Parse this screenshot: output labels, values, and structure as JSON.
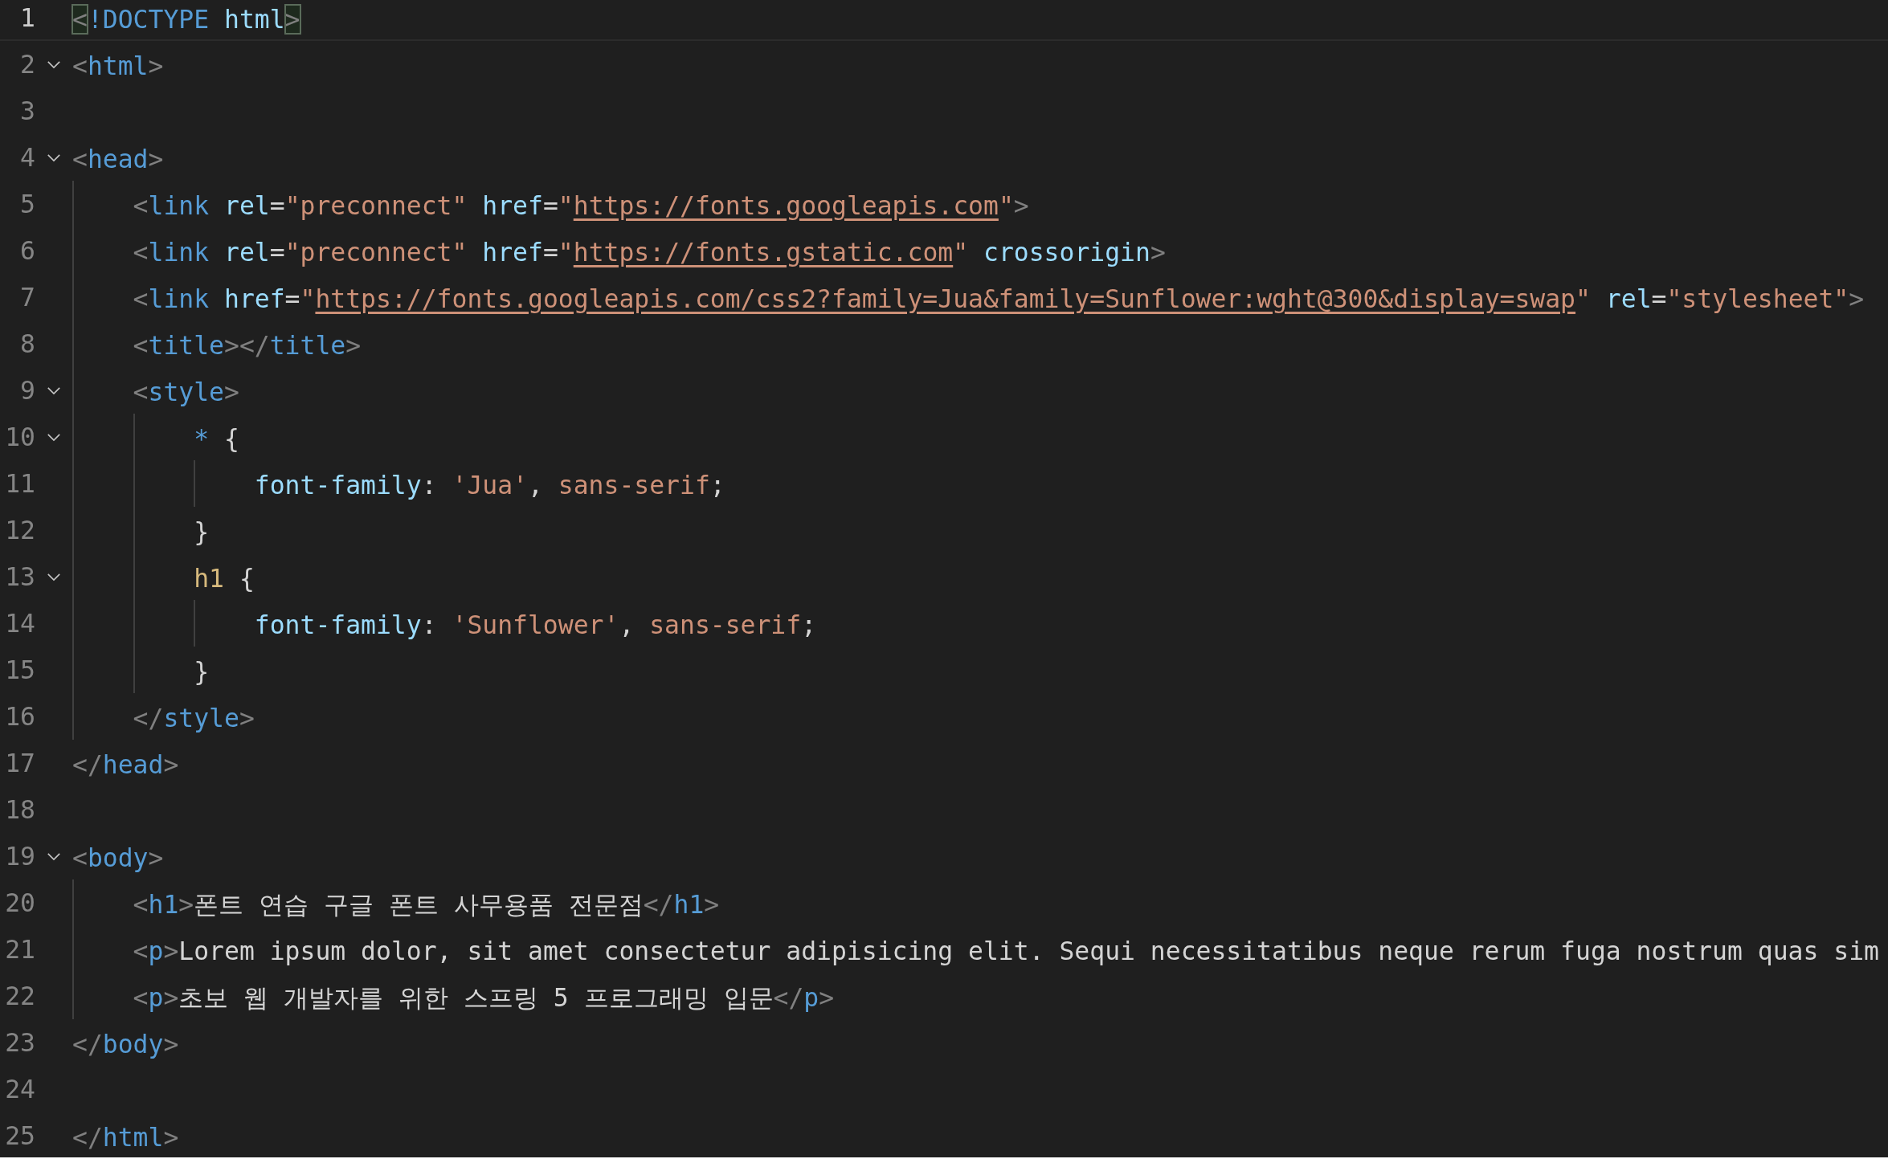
{
  "editor": {
    "lines": [
      {
        "number": "1",
        "fold": false,
        "current": true,
        "tokens": [
          {
            "kind": "bracket-match",
            "text": "<"
          },
          {
            "kind": "tag",
            "text": "!DOCTYPE"
          },
          {
            "kind": "attr",
            "text": " html"
          },
          {
            "kind": "bracket-match",
            "text": ">"
          }
        ]
      },
      {
        "number": "2",
        "fold": true,
        "current": false,
        "tokens": [
          {
            "kind": "punct",
            "text": "<"
          },
          {
            "kind": "tag",
            "text": "html"
          },
          {
            "kind": "punct",
            "text": ">"
          }
        ]
      },
      {
        "number": "3",
        "fold": false,
        "current": false
      },
      {
        "number": "4",
        "fold": true,
        "current": false,
        "tokens": [
          {
            "kind": "punct",
            "text": "<"
          },
          {
            "kind": "tag",
            "text": "head"
          },
          {
            "kind": "punct",
            "text": ">"
          }
        ]
      },
      {
        "number": "5",
        "fold": false,
        "current": false,
        "tokens": [
          {
            "kind": "punct",
            "text": "    <"
          },
          {
            "kind": "tag",
            "text": "link"
          },
          {
            "kind": "attr",
            "text": " rel"
          },
          {
            "kind": "text",
            "text": "="
          },
          {
            "kind": "string",
            "text": "\"preconnect\""
          },
          {
            "kind": "attr",
            "text": " href"
          },
          {
            "kind": "text",
            "text": "="
          },
          {
            "kind": "string",
            "text": "\""
          },
          {
            "kind": "link",
            "text": "https://fonts.googleapis.com"
          },
          {
            "kind": "string",
            "text": "\""
          },
          {
            "kind": "punct",
            "text": ">"
          }
        ]
      },
      {
        "number": "6",
        "fold": false,
        "current": false,
        "tokens": [
          {
            "kind": "punct",
            "text": "    <"
          },
          {
            "kind": "tag",
            "text": "link"
          },
          {
            "kind": "attr",
            "text": " rel"
          },
          {
            "kind": "text",
            "text": "="
          },
          {
            "kind": "string",
            "text": "\"preconnect\""
          },
          {
            "kind": "attr",
            "text": " href"
          },
          {
            "kind": "text",
            "text": "="
          },
          {
            "kind": "string",
            "text": "\""
          },
          {
            "kind": "link",
            "text": "https://fonts.gstatic.com"
          },
          {
            "kind": "string",
            "text": "\""
          },
          {
            "kind": "attr",
            "text": " crossorigin"
          },
          {
            "kind": "punct",
            "text": ">"
          }
        ]
      },
      {
        "number": "7",
        "fold": false,
        "current": false,
        "tokens": [
          {
            "kind": "punct",
            "text": "    <"
          },
          {
            "kind": "tag",
            "text": "link"
          },
          {
            "kind": "attr",
            "text": " href"
          },
          {
            "kind": "text",
            "text": "="
          },
          {
            "kind": "string",
            "text": "\""
          },
          {
            "kind": "link",
            "text": "https://fonts.googleapis.com/css2?family=Jua&family=Sunflower:wght@300&display=swap"
          },
          {
            "kind": "string",
            "text": "\""
          },
          {
            "kind": "attr",
            "text": " rel"
          },
          {
            "kind": "text",
            "text": "="
          },
          {
            "kind": "string",
            "text": "\"stylesheet\""
          },
          {
            "kind": "punct",
            "text": ">"
          }
        ]
      },
      {
        "number": "8",
        "fold": false,
        "current": false,
        "tokens": [
          {
            "kind": "punct",
            "text": "    <"
          },
          {
            "kind": "tag",
            "text": "title"
          },
          {
            "kind": "punct",
            "text": "></"
          },
          {
            "kind": "tag",
            "text": "title"
          },
          {
            "kind": "punct",
            "text": ">"
          }
        ]
      },
      {
        "number": "9",
        "fold": true,
        "current": false,
        "tokens": [
          {
            "kind": "punct",
            "text": "    <"
          },
          {
            "kind": "tag",
            "text": "style"
          },
          {
            "kind": "punct",
            "text": ">"
          }
        ]
      },
      {
        "number": "10",
        "fold": true,
        "current": false,
        "tokens": [
          {
            "kind": "tag",
            "text": "        *"
          },
          {
            "kind": "text",
            "text": " {"
          }
        ]
      },
      {
        "number": "11",
        "fold": false,
        "current": false,
        "tokens": [
          {
            "kind": "attr",
            "text": "            font-family"
          },
          {
            "kind": "text",
            "text": ":"
          },
          {
            "kind": "string",
            "text": " 'Jua'"
          },
          {
            "kind": "text",
            "text": ","
          },
          {
            "kind": "string",
            "text": " sans-serif"
          },
          {
            "kind": "text",
            "text": ";"
          }
        ]
      },
      {
        "number": "12",
        "fold": false,
        "current": false,
        "tokens": [
          {
            "kind": "text",
            "text": "        }"
          }
        ]
      },
      {
        "number": "13",
        "fold": true,
        "current": false,
        "tokens": [
          {
            "kind": "selector",
            "text": "        h1"
          },
          {
            "kind": "text",
            "text": " {"
          }
        ]
      },
      {
        "number": "14",
        "fold": false,
        "current": false,
        "tokens": [
          {
            "kind": "attr",
            "text": "            font-family"
          },
          {
            "kind": "text",
            "text": ":"
          },
          {
            "kind": "string",
            "text": " 'Sunflower'"
          },
          {
            "kind": "text",
            "text": ","
          },
          {
            "kind": "string",
            "text": " sans-serif"
          },
          {
            "kind": "text",
            "text": ";"
          }
        ]
      },
      {
        "number": "15",
        "fold": false,
        "current": false,
        "tokens": [
          {
            "kind": "text",
            "text": "        }"
          }
        ]
      },
      {
        "number": "16",
        "fold": false,
        "current": false,
        "tokens": [
          {
            "kind": "punct",
            "text": "    </"
          },
          {
            "kind": "tag",
            "text": "style"
          },
          {
            "kind": "punct",
            "text": ">"
          }
        ]
      },
      {
        "number": "17",
        "fold": false,
        "current": false,
        "tokens": [
          {
            "kind": "punct",
            "text": "</"
          },
          {
            "kind": "tag",
            "text": "head"
          },
          {
            "kind": "punct",
            "text": ">"
          }
        ]
      },
      {
        "number": "18",
        "fold": false,
        "current": false
      },
      {
        "number": "19",
        "fold": true,
        "current": false,
        "tokens": [
          {
            "kind": "punct",
            "text": "<"
          },
          {
            "kind": "tag",
            "text": "body"
          },
          {
            "kind": "punct",
            "text": ">"
          }
        ]
      },
      {
        "number": "20",
        "fold": false,
        "current": false,
        "tokens": [
          {
            "kind": "punct",
            "text": "    <"
          },
          {
            "kind": "tag",
            "text": "h1"
          },
          {
            "kind": "punct",
            "text": ">"
          },
          {
            "kind": "text",
            "text": "폰트 연습 구글 폰트 사무용품 전문점"
          },
          {
            "kind": "punct",
            "text": "</"
          },
          {
            "kind": "tag",
            "text": "h1"
          },
          {
            "kind": "punct",
            "text": ">"
          }
        ]
      },
      {
        "number": "21",
        "fold": false,
        "current": false,
        "tokens": [
          {
            "kind": "punct",
            "text": "    <"
          },
          {
            "kind": "tag",
            "text": "p"
          },
          {
            "kind": "punct",
            "text": ">"
          },
          {
            "kind": "text",
            "text": "Lorem ipsum dolor, sit amet consectetur adipisicing elit. Sequi necessitatibus neque rerum fuga nostrum quas sim"
          }
        ]
      },
      {
        "number": "22",
        "fold": false,
        "current": false,
        "tokens": [
          {
            "kind": "punct",
            "text": "    <"
          },
          {
            "kind": "tag",
            "text": "p"
          },
          {
            "kind": "punct",
            "text": ">"
          },
          {
            "kind": "text",
            "text": "초보 웹 개발자를 위한 스프링 5 프로그래밍 입문"
          },
          {
            "kind": "punct",
            "text": "</"
          },
          {
            "kind": "tag",
            "text": "p"
          },
          {
            "kind": "punct",
            "text": ">"
          }
        ]
      },
      {
        "number": "23",
        "fold": false,
        "current": false,
        "tokens": [
          {
            "kind": "punct",
            "text": "</"
          },
          {
            "kind": "tag",
            "text": "body"
          },
          {
            "kind": "punct",
            "text": ">"
          }
        ]
      },
      {
        "number": "24",
        "fold": false,
        "current": false
      },
      {
        "number": "25",
        "fold": false,
        "current": false,
        "tokens": [
          {
            "kind": "punct",
            "text": "</"
          },
          {
            "kind": "tag",
            "text": "html"
          },
          {
            "kind": "punct",
            "text": ">"
          }
        ]
      }
    ]
  }
}
